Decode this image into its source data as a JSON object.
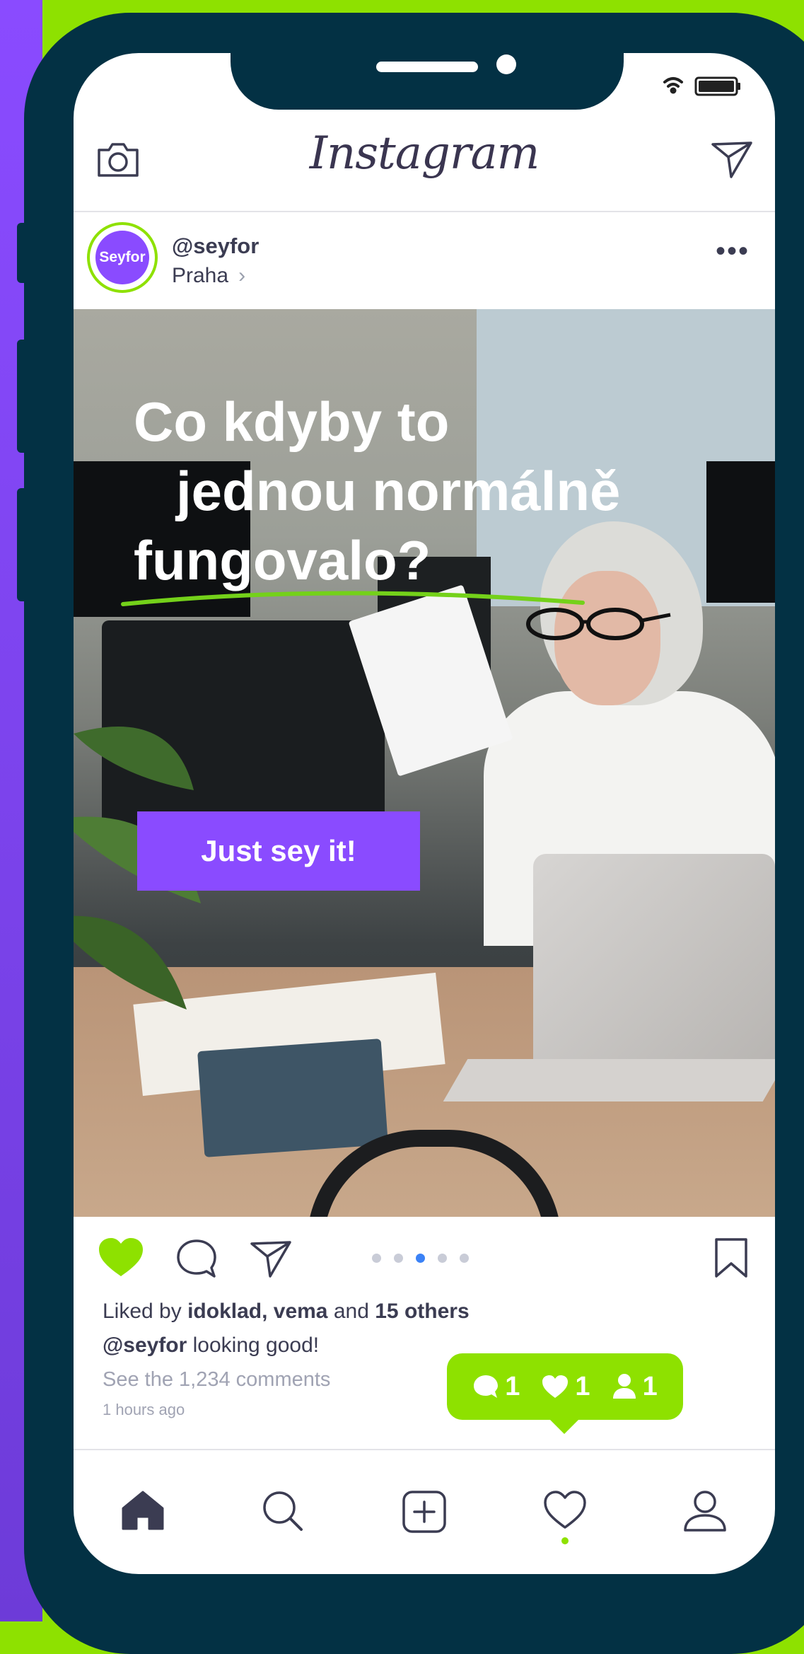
{
  "app": {
    "logo": "Instagram"
  },
  "post": {
    "username": "@seyfor",
    "location": "Praha",
    "location_chevron": "›",
    "avatar_text": "Seyfor",
    "more": "•••",
    "headline": [
      "Co kdyby to",
      "jednou normálně",
      "fungovalo?"
    ],
    "cta": "Just sey it!",
    "carousel": {
      "count": 5,
      "active_index": 2
    },
    "liked": true
  },
  "engagement": {
    "liked_by_prefix": "Liked by ",
    "liked_by_names": "idoklad, vema",
    "liked_by_and": " and ",
    "liked_by_others": "15 others",
    "caption_user": "@seyfor",
    "caption_text": " looking good!",
    "comments_link": "See the 1,234 comments",
    "time": "1 hours ago"
  },
  "notification": {
    "comments": "1",
    "likes": "1",
    "followers": "1"
  },
  "tabbar": {
    "items": [
      "home-icon",
      "search-icon",
      "add-post-icon",
      "activity-icon",
      "profile-icon"
    ],
    "active": "home-icon"
  },
  "colors": {
    "accent_green": "#8ee100",
    "purple": "#8a4bff",
    "frame": "#033144",
    "text": "#3b3c52"
  }
}
